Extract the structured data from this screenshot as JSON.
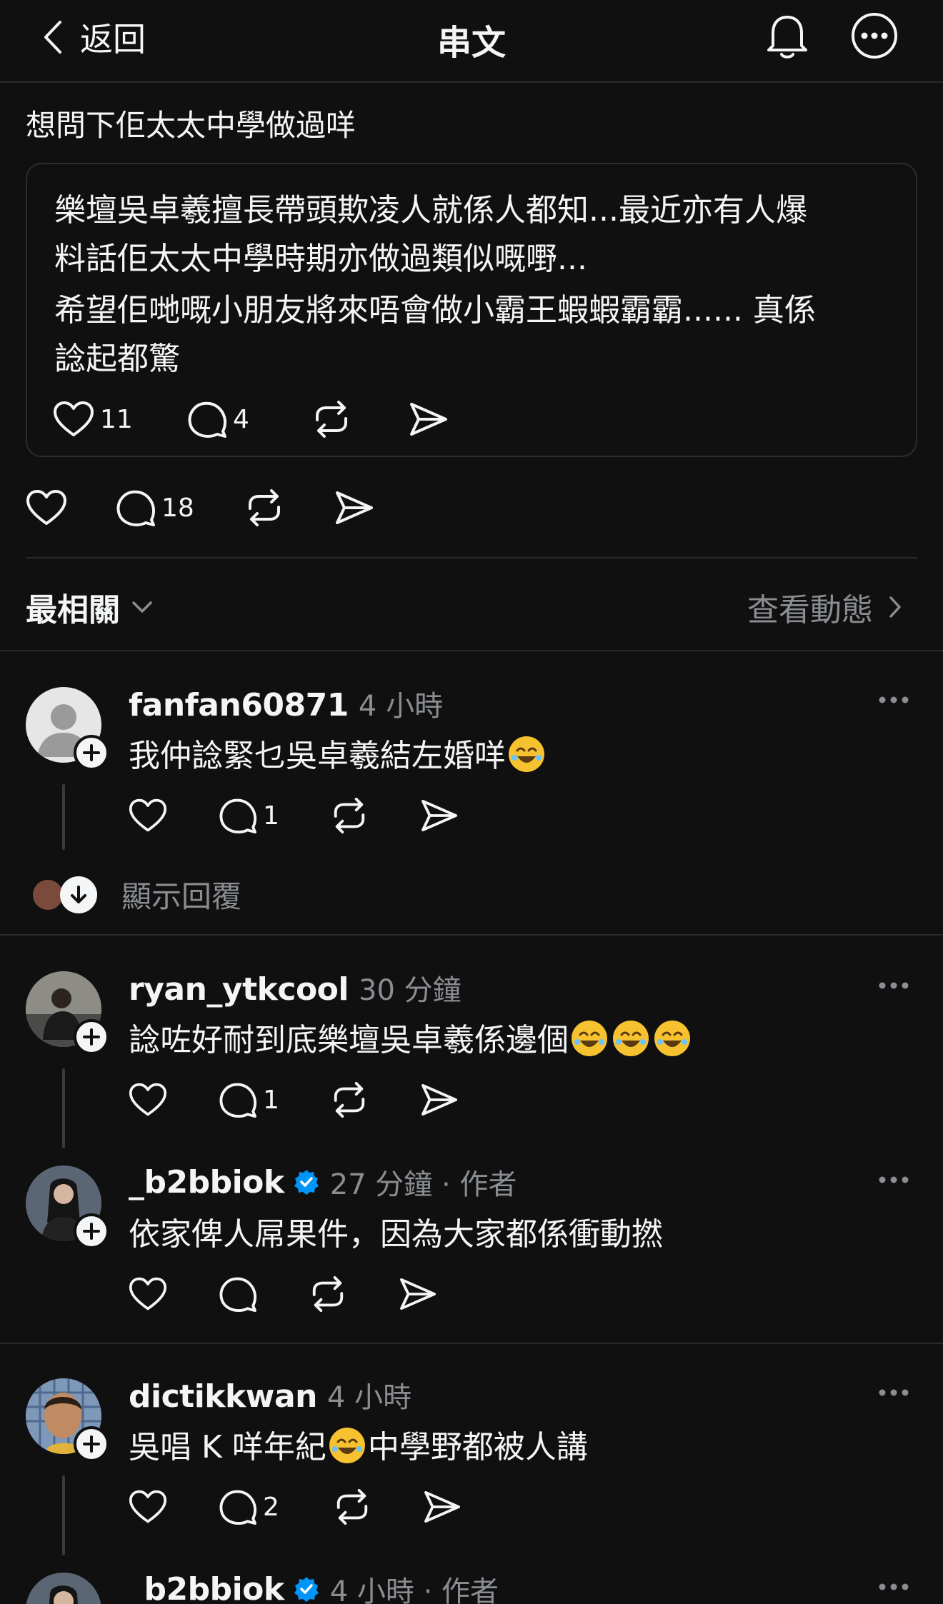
{
  "header": {
    "back_label": "返回",
    "title": "串文"
  },
  "post": {
    "caption": "想問下佢太太中學做過咩",
    "quote_lines": [
      "樂壇吳卓羲擅長帶頭欺凌人就係人都知...最近亦有人爆",
      "料話佢太太中學時期亦做過類似嘅嘢...",
      "希望佢哋嘅小朋友將來唔會做小霸王蝦蝦霸霸...... 真係",
      "諗起都驚"
    ],
    "quote_likes": "11",
    "quote_replies": "4",
    "replies": "18"
  },
  "sort": {
    "label": "最相關",
    "activity_label": "查看動態"
  },
  "comments": [
    {
      "username": "fanfan60871",
      "time": "4 小時",
      "text": "我仲諗緊乜吳卓羲結左婚咩",
      "replies": "1",
      "show_replies": "顯示回覆"
    },
    {
      "username": "ryan_ytkcool",
      "time": "30 分鐘",
      "text": "諗咗好耐到底樂壇吳卓羲係邊個",
      "replies": "1"
    },
    {
      "username": "_b2bbiok",
      "time": "27 分鐘 · 作者",
      "text": "依家俾人屌果件，因為大家都係衝動撚",
      "replies": ""
    },
    {
      "username": "dictikkwan",
      "time": "4 小時",
      "text_a": "吳唱 K 咩年紀",
      "text_b": "中學野都被人講",
      "replies": "2"
    },
    {
      "username": "_b2bbiok",
      "time": "4 小時 · 作者"
    }
  ],
  "colors": {
    "background": "#101010",
    "text": "#f3f5f7",
    "muted": "#8a8d91",
    "verified": "#0095f6"
  }
}
